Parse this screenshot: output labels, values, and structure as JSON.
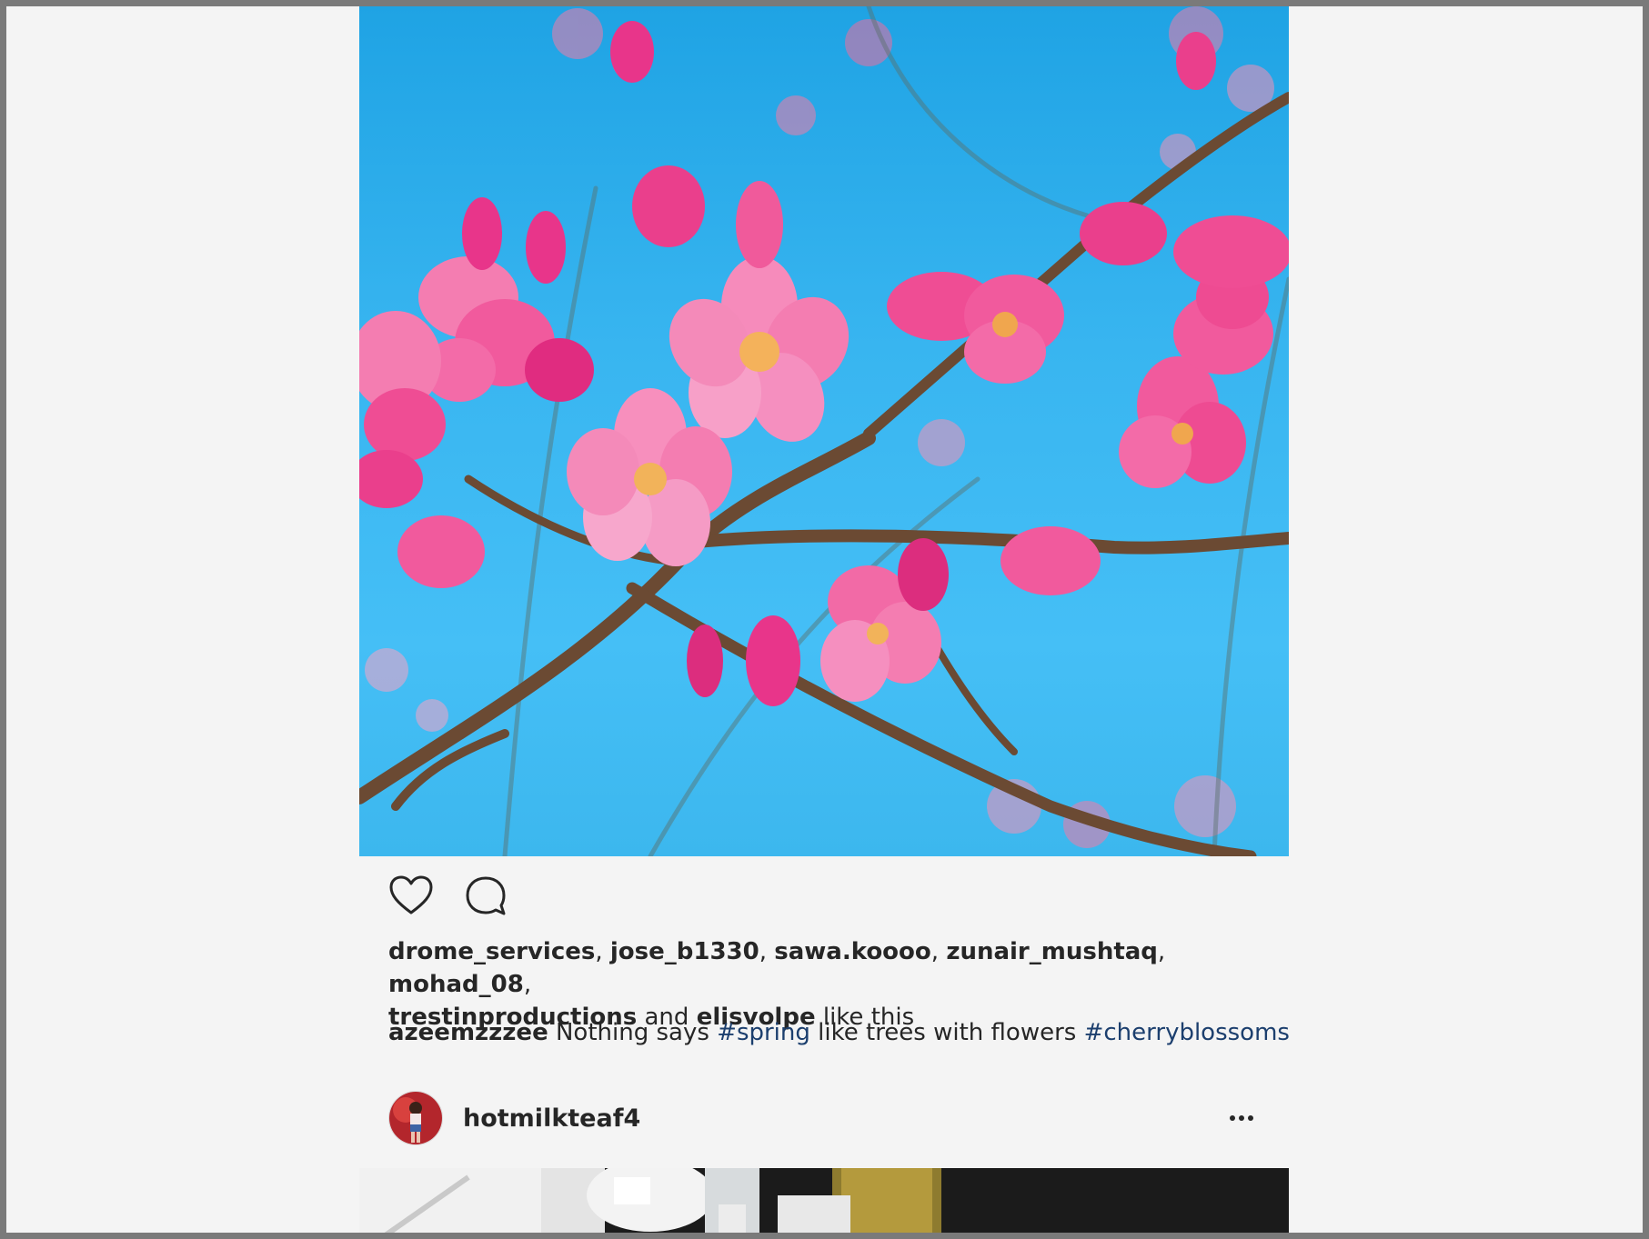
{
  "post": {
    "photo_alt": "",
    "actions": {
      "like_icon": "heart-icon",
      "comment_icon": "comment-icon"
    },
    "likes": {
      "users": [
        "drome_services",
        "jose_b1330",
        "sawa.koooo",
        "zunair_mushtaq",
        "mohad_08",
        "trestinproductions"
      ],
      "separator": ", ",
      "and_word": " and ",
      "last_user": "elisvolpe",
      "suffix": " like this"
    },
    "caption": {
      "username": "azeemzzzee",
      "text_1": " Nothing says ",
      "tag_1": "#spring",
      "text_2": " like trees with flowers ",
      "tag_2": "#cherryblossoms"
    }
  },
  "next_post": {
    "username": "hotmilkteaf4",
    "more_icon": "more-options-icon"
  },
  "colors": {
    "background": "#f4f4f4",
    "text": "#262626",
    "hashtag": "#1c3f6e",
    "sky": "#38b5f0",
    "blossom": "#f0559a"
  }
}
